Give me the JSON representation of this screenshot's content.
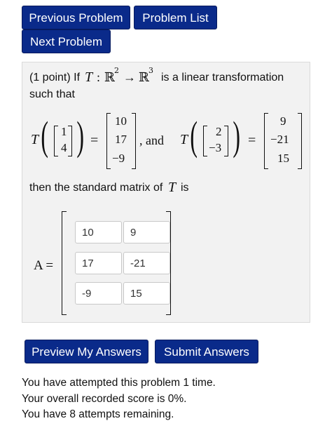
{
  "nav": {
    "previous_label": "Previous Problem",
    "list_label": "Problem List",
    "next_label": "Next Problem"
  },
  "problem": {
    "intro_points": "(1 point) If",
    "T": "T",
    "colon": ":",
    "domain": "ℝ",
    "domain_exp": "2",
    "arrow": "→",
    "codomain": "ℝ",
    "codomain_exp": "3",
    "intro_rest": "is a linear transformation",
    "intro_line2": "such that",
    "vec1_input": [
      "1",
      "4"
    ],
    "vec1_output": [
      "10",
      "17",
      "−9"
    ],
    "and_text": ", and",
    "vec2_input": [
      "2",
      "−3"
    ],
    "vec2_output": [
      "9",
      "−21",
      "15"
    ],
    "equals": "=",
    "question_text": "then the standard matrix of",
    "question_T": "T",
    "question_is": "is",
    "matrix_label": "A =",
    "matrix_answers": [
      [
        "10",
        "9"
      ],
      [
        "17",
        "-21"
      ],
      [
        "-9",
        "15"
      ]
    ]
  },
  "actions": {
    "preview_label": "Preview My Answers",
    "submit_label": "Submit Answers"
  },
  "status": {
    "attempts": "You have attempted this problem 1 time.",
    "score": "Your overall recorded score is 0%.",
    "remaining_partial": "You have 8 attempts remaining."
  }
}
